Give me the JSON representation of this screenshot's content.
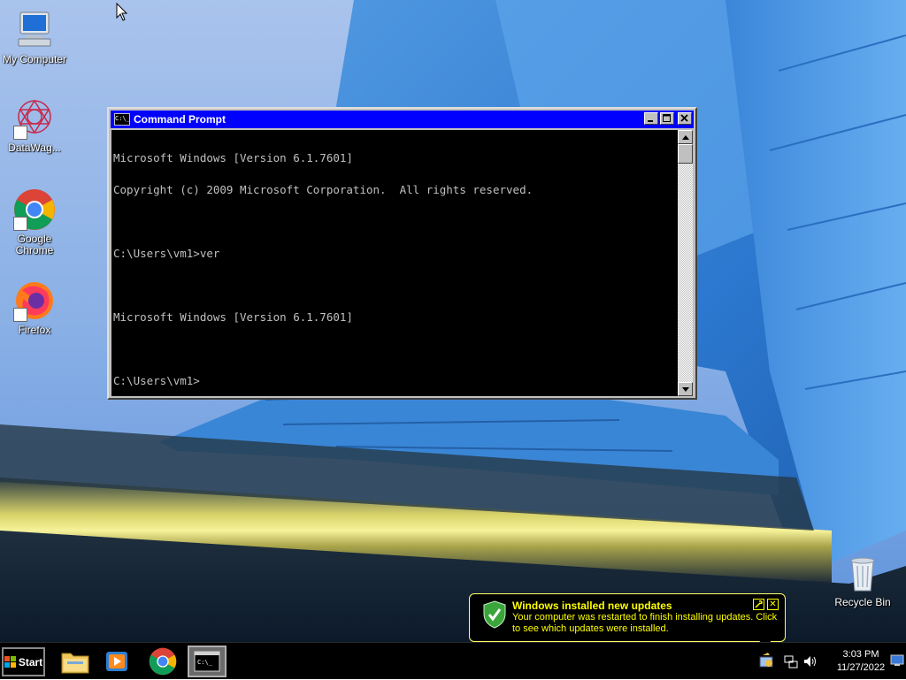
{
  "desktop": {
    "icons": [
      {
        "label": "My Computer"
      },
      {
        "label": "DataWag..."
      },
      {
        "label": "Google Chrome"
      },
      {
        "label": "Firefox"
      },
      {
        "label": "Recycle Bin"
      }
    ]
  },
  "cmd_window": {
    "title": "Command Prompt",
    "icon_text": "C:\\_",
    "lines": [
      "Microsoft Windows [Version 6.1.7601]",
      "Copyright (c) 2009 Microsoft Corporation.  All rights reserved.",
      "",
      "C:\\Users\\vm1>ver",
      "",
      "Microsoft Windows [Version 6.1.7601]",
      "",
      "C:\\Users\\vm1>"
    ],
    "minimize_label": "_",
    "maximize_label": "□",
    "close_label": "✕"
  },
  "balloon": {
    "title": "Windows installed new updates",
    "text": "Your computer was restarted to finish installing updates. Click to see which updates were installed.",
    "options_icon": "wrench-icon",
    "close_label": "✕"
  },
  "taskbar": {
    "start_label": "Start",
    "pinned": [
      {
        "name": "file-explorer"
      },
      {
        "name": "media-player"
      },
      {
        "name": "chrome"
      },
      {
        "name": "command-prompt",
        "active": true
      }
    ],
    "clock_time": "3:03 PM",
    "clock_date": "11/27/2022"
  },
  "colors": {
    "title_bar": "#0000ff",
    "console_bg": "#000000",
    "console_text": "#c0c0c0",
    "balloon_text": "#ffff00"
  }
}
